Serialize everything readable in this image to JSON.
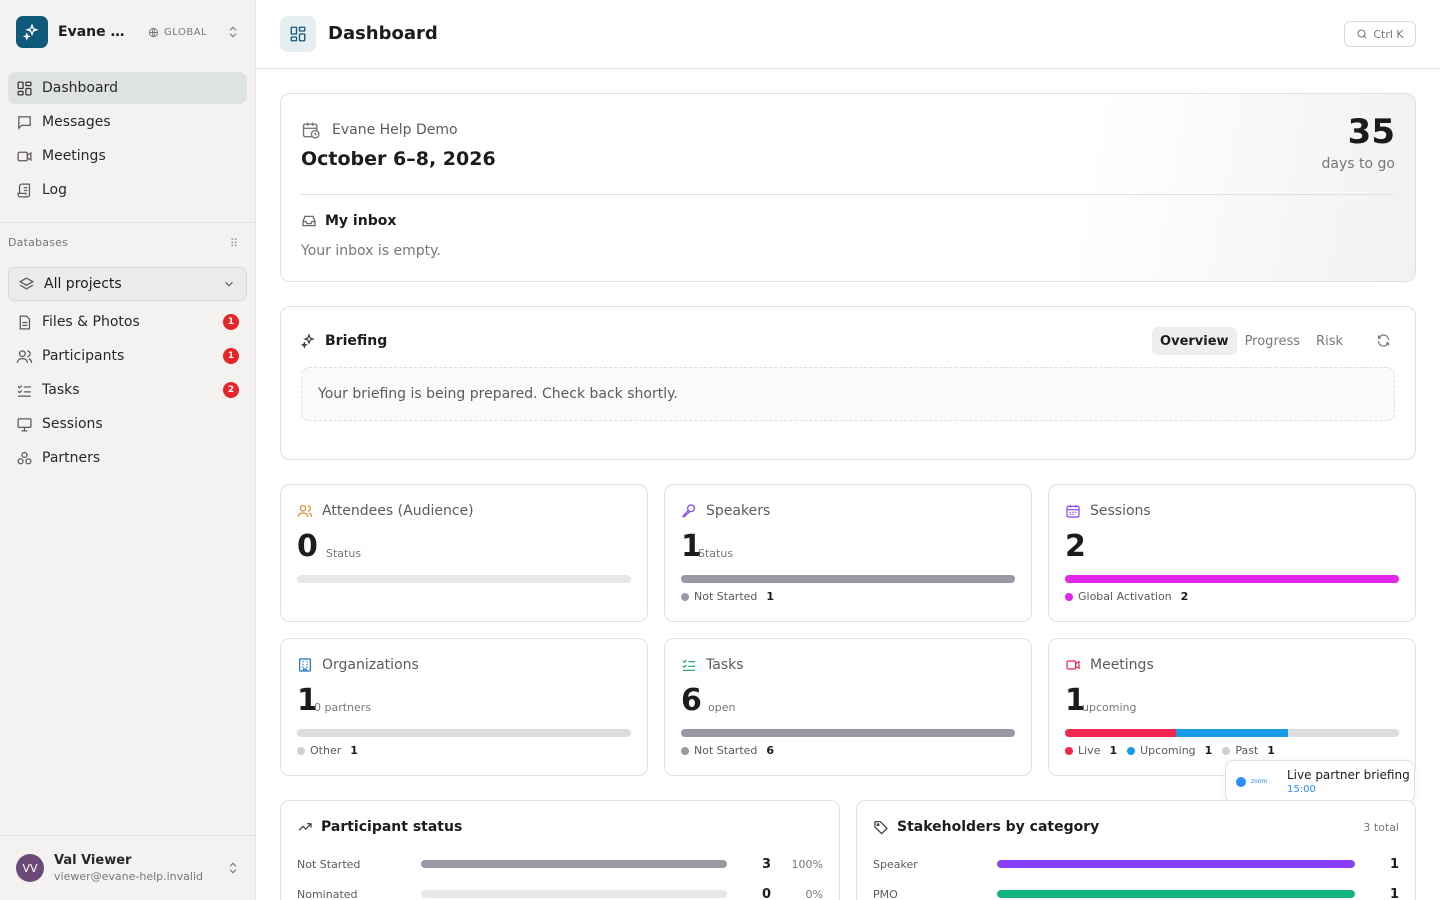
{
  "workspace": {
    "name": "Evane Help Demo",
    "scope": "GLOBAL"
  },
  "nav": [
    {
      "label": "Dashboard",
      "icon": "grid-icon",
      "active": true
    },
    {
      "label": "Messages",
      "icon": "message-icon"
    },
    {
      "label": "Meetings",
      "icon": "video-icon"
    },
    {
      "label": "Log",
      "icon": "scroll-icon"
    }
  ],
  "databases": {
    "label": "Databases",
    "project_selector": "All projects",
    "items": [
      {
        "label": "Files & Photos",
        "badge": "1"
      },
      {
        "label": "Participants",
        "badge": "1"
      },
      {
        "label": "Tasks",
        "badge": "2"
      },
      {
        "label": "Sessions",
        "badge": ""
      },
      {
        "label": "Partners",
        "badge": ""
      }
    ]
  },
  "user": {
    "initials": "VV",
    "name": "Val Viewer",
    "email": "viewer@evane-help.invalid"
  },
  "header": {
    "title": "Dashboard",
    "search_shortcut": "Ctrl K"
  },
  "event": {
    "name": "Evane Help Demo",
    "dates": "October 6–8, 2026",
    "days_count": "35",
    "days_label": "days to go",
    "inbox_title": "My inbox",
    "inbox_empty": "Your inbox is empty."
  },
  "briefing": {
    "title": "Briefing",
    "tabs": [
      "Overview",
      "Progress",
      "Risk"
    ],
    "active_tab": "Overview",
    "message": "Your briefing is being prepared. Check back shortly."
  },
  "stats": {
    "attendees": {
      "title": "Attendees (Audience)",
      "value": "0",
      "sub": "Status",
      "color": "#d98a2b"
    },
    "speakers": {
      "title": "Speakers",
      "value": "1",
      "sub": "Status",
      "legend": [
        {
          "label": "Not Started",
          "value": "1",
          "color": "#9a99a3"
        }
      ],
      "color": "#8a3ffc"
    },
    "sessions": {
      "title": "Sessions",
      "value": "2",
      "sub": "",
      "legend": [
        {
          "label": "Global Activation",
          "value": "2",
          "color": "#e026e8"
        }
      ],
      "color": "#8a3ffc"
    },
    "organizations": {
      "title": "Organizations",
      "value": "1",
      "sub": "0 partners",
      "legend": [
        {
          "label": "Other",
          "value": "1",
          "color": "#cfcfcf"
        }
      ],
      "color": "#1a73c7"
    },
    "tasks": {
      "title": "Tasks",
      "value": "6",
      "sub": "open",
      "legend": [
        {
          "label": "Not Started",
          "value": "6",
          "color": "#9a99a3"
        }
      ],
      "color": "#12a07a"
    },
    "meetings": {
      "title": "Meetings",
      "value": "1",
      "sub": "upcoming",
      "color": "#e8264a",
      "legend": [
        {
          "label": "Live",
          "value": "1",
          "color": "#f02550"
        },
        {
          "label": "Upcoming",
          "value": "1",
          "color": "#1a9be8"
        },
        {
          "label": "Past",
          "value": "1",
          "color": "#cfcfcf"
        }
      ]
    }
  },
  "toast": {
    "brand": "zoom",
    "title": "Live partner briefing",
    "time": "15:00"
  },
  "participant_status": {
    "title": "Participant status",
    "rows": [
      {
        "label": "Not Started",
        "value": "3",
        "percent": "100%",
        "fraction": 1.0,
        "color": "#9a99a3"
      },
      {
        "label": "Nominated",
        "value": "0",
        "percent": "0%",
        "fraction": 0,
        "color": "#9a99a3"
      }
    ]
  },
  "stakeholders": {
    "title": "Stakeholders by category",
    "total": "3 total",
    "rows": [
      {
        "label": "Speaker",
        "value": "1",
        "fraction": 1.0,
        "color": "#8a3ffc"
      },
      {
        "label": "PMO",
        "value": "1",
        "fraction": 1.0,
        "color": "#12b37e"
      }
    ]
  }
}
